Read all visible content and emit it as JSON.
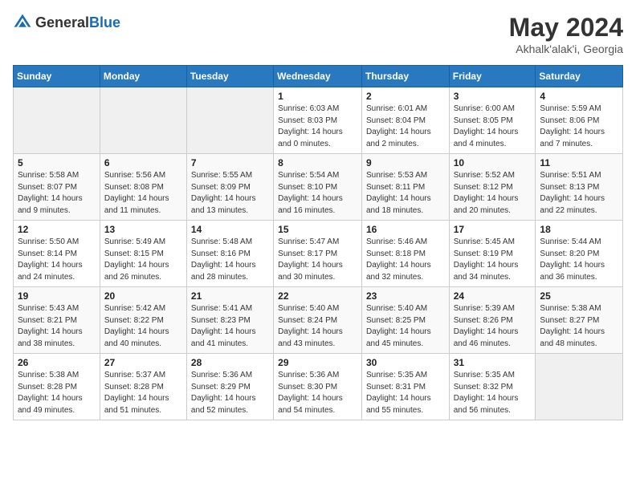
{
  "header": {
    "logo_general": "General",
    "logo_blue": "Blue",
    "month_year": "May 2024",
    "location": "Akhalk'alak'i, Georgia"
  },
  "days_of_week": [
    "Sunday",
    "Monday",
    "Tuesday",
    "Wednesday",
    "Thursday",
    "Friday",
    "Saturday"
  ],
  "weeks": [
    {
      "days": [
        {
          "num": "",
          "info": ""
        },
        {
          "num": "",
          "info": ""
        },
        {
          "num": "",
          "info": ""
        },
        {
          "num": "1",
          "info": "Sunrise: 6:03 AM\nSunset: 8:03 PM\nDaylight: 14 hours\nand 0 minutes."
        },
        {
          "num": "2",
          "info": "Sunrise: 6:01 AM\nSunset: 8:04 PM\nDaylight: 14 hours\nand 2 minutes."
        },
        {
          "num": "3",
          "info": "Sunrise: 6:00 AM\nSunset: 8:05 PM\nDaylight: 14 hours\nand 4 minutes."
        },
        {
          "num": "4",
          "info": "Sunrise: 5:59 AM\nSunset: 8:06 PM\nDaylight: 14 hours\nand 7 minutes."
        }
      ]
    },
    {
      "days": [
        {
          "num": "5",
          "info": "Sunrise: 5:58 AM\nSunset: 8:07 PM\nDaylight: 14 hours\nand 9 minutes."
        },
        {
          "num": "6",
          "info": "Sunrise: 5:56 AM\nSunset: 8:08 PM\nDaylight: 14 hours\nand 11 minutes."
        },
        {
          "num": "7",
          "info": "Sunrise: 5:55 AM\nSunset: 8:09 PM\nDaylight: 14 hours\nand 13 minutes."
        },
        {
          "num": "8",
          "info": "Sunrise: 5:54 AM\nSunset: 8:10 PM\nDaylight: 14 hours\nand 16 minutes."
        },
        {
          "num": "9",
          "info": "Sunrise: 5:53 AM\nSunset: 8:11 PM\nDaylight: 14 hours\nand 18 minutes."
        },
        {
          "num": "10",
          "info": "Sunrise: 5:52 AM\nSunset: 8:12 PM\nDaylight: 14 hours\nand 20 minutes."
        },
        {
          "num": "11",
          "info": "Sunrise: 5:51 AM\nSunset: 8:13 PM\nDaylight: 14 hours\nand 22 minutes."
        }
      ]
    },
    {
      "days": [
        {
          "num": "12",
          "info": "Sunrise: 5:50 AM\nSunset: 8:14 PM\nDaylight: 14 hours\nand 24 minutes."
        },
        {
          "num": "13",
          "info": "Sunrise: 5:49 AM\nSunset: 8:15 PM\nDaylight: 14 hours\nand 26 minutes."
        },
        {
          "num": "14",
          "info": "Sunrise: 5:48 AM\nSunset: 8:16 PM\nDaylight: 14 hours\nand 28 minutes."
        },
        {
          "num": "15",
          "info": "Sunrise: 5:47 AM\nSunset: 8:17 PM\nDaylight: 14 hours\nand 30 minutes."
        },
        {
          "num": "16",
          "info": "Sunrise: 5:46 AM\nSunset: 8:18 PM\nDaylight: 14 hours\nand 32 minutes."
        },
        {
          "num": "17",
          "info": "Sunrise: 5:45 AM\nSunset: 8:19 PM\nDaylight: 14 hours\nand 34 minutes."
        },
        {
          "num": "18",
          "info": "Sunrise: 5:44 AM\nSunset: 8:20 PM\nDaylight: 14 hours\nand 36 minutes."
        }
      ]
    },
    {
      "days": [
        {
          "num": "19",
          "info": "Sunrise: 5:43 AM\nSunset: 8:21 PM\nDaylight: 14 hours\nand 38 minutes."
        },
        {
          "num": "20",
          "info": "Sunrise: 5:42 AM\nSunset: 8:22 PM\nDaylight: 14 hours\nand 40 minutes."
        },
        {
          "num": "21",
          "info": "Sunrise: 5:41 AM\nSunset: 8:23 PM\nDaylight: 14 hours\nand 41 minutes."
        },
        {
          "num": "22",
          "info": "Sunrise: 5:40 AM\nSunset: 8:24 PM\nDaylight: 14 hours\nand 43 minutes."
        },
        {
          "num": "23",
          "info": "Sunrise: 5:40 AM\nSunset: 8:25 PM\nDaylight: 14 hours\nand 45 minutes."
        },
        {
          "num": "24",
          "info": "Sunrise: 5:39 AM\nSunset: 8:26 PM\nDaylight: 14 hours\nand 46 minutes."
        },
        {
          "num": "25",
          "info": "Sunrise: 5:38 AM\nSunset: 8:27 PM\nDaylight: 14 hours\nand 48 minutes."
        }
      ]
    },
    {
      "days": [
        {
          "num": "26",
          "info": "Sunrise: 5:38 AM\nSunset: 8:28 PM\nDaylight: 14 hours\nand 49 minutes."
        },
        {
          "num": "27",
          "info": "Sunrise: 5:37 AM\nSunset: 8:28 PM\nDaylight: 14 hours\nand 51 minutes."
        },
        {
          "num": "28",
          "info": "Sunrise: 5:36 AM\nSunset: 8:29 PM\nDaylight: 14 hours\nand 52 minutes."
        },
        {
          "num": "29",
          "info": "Sunrise: 5:36 AM\nSunset: 8:30 PM\nDaylight: 14 hours\nand 54 minutes."
        },
        {
          "num": "30",
          "info": "Sunrise: 5:35 AM\nSunset: 8:31 PM\nDaylight: 14 hours\nand 55 minutes."
        },
        {
          "num": "31",
          "info": "Sunrise: 5:35 AM\nSunset: 8:32 PM\nDaylight: 14 hours\nand 56 minutes."
        },
        {
          "num": "",
          "info": ""
        }
      ]
    }
  ]
}
